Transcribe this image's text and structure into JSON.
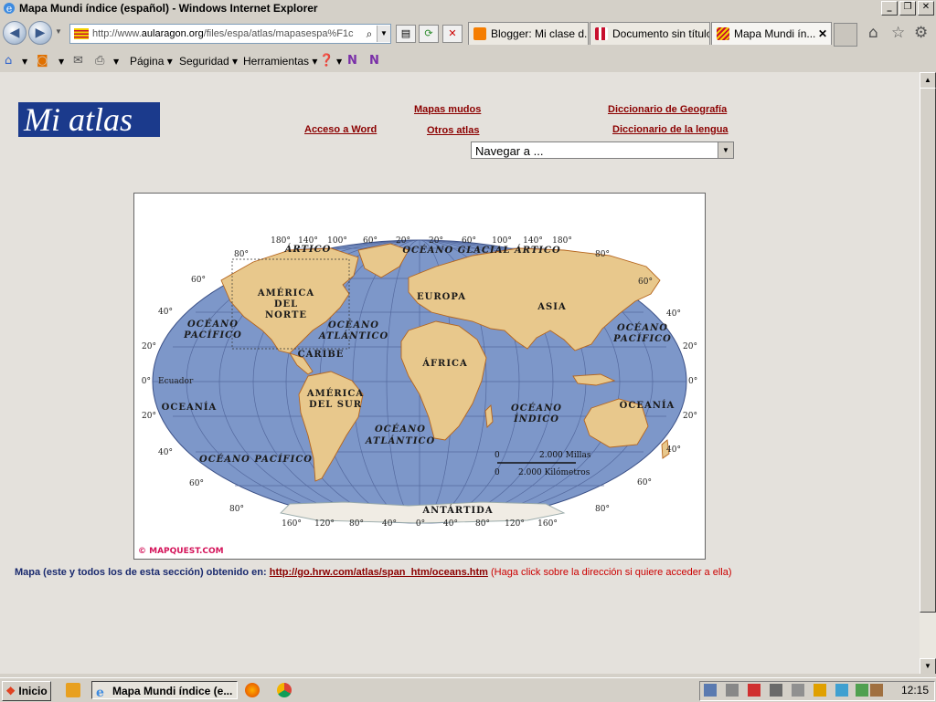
{
  "window": {
    "title": "Mapa Mundi índice (español) - Windows Internet Explorer"
  },
  "nav": {
    "url_prefix": "http://www.",
    "url_domain": "aularagon.org",
    "url_path": "/files/espa/atlas/mapasespa%F1c"
  },
  "tabs": [
    {
      "label": "Blogger: Mi clase d...",
      "color": "#f57d00"
    },
    {
      "label": "Documento sin título",
      "color": "#c8102e"
    },
    {
      "label": "Mapa Mundi ín...",
      "color": "#f4d000"
    }
  ],
  "commandbar": {
    "page": "Página",
    "security": "Seguridad",
    "tools": "Herramientas"
  },
  "page": {
    "logo": "Mi atlas",
    "links": {
      "mapas_mudos": "Mapas mudos",
      "dic_geografia": "Diccionario de Geografía",
      "acceso_word": "Acceso a Word",
      "otros_atlas": "Otros atlas",
      "dic_lengua": "Diccionario de la lengua"
    },
    "navigate_select": "Navegar a ...",
    "footer": {
      "text": "Mapa (este y todos los de esta sección) obtenido en:",
      "link": "http://go.hrw.com/atlas/span_htm/oceans.htm",
      "hint": "(Haga click sobre la dirección si quiere acceder a ella)"
    }
  },
  "map": {
    "top_longitudes": [
      "180°",
      "140°",
      "100°",
      "60°",
      "20°",
      "20°",
      "60°",
      "100°",
      "140°",
      "180°"
    ],
    "bottom_longitudes": [
      "160°",
      "120°",
      "80°",
      "40°",
      "0°",
      "40°",
      "80°",
      "120°",
      "160°"
    ],
    "left_latitudes": [
      "80°",
      "60°",
      "40°",
      "20°",
      "0°",
      "20°",
      "40°",
      "60°",
      "80°"
    ],
    "right_latitudes": [
      "80°",
      "60°",
      "40°",
      "20°",
      "0°",
      "20°",
      "40°",
      "60°",
      "80°"
    ],
    "equator": "Ecuador",
    "labels": {
      "artico": "ÁRTICO",
      "glacial": "OCÉANO GLACIAL ÁRTICO",
      "america_norte_1": "AMÉRICA",
      "america_norte_2": "DEL",
      "america_norte_3": "NORTE",
      "europa": "EUROPA",
      "asia": "ASIA",
      "pacifico_w1": "OCÉANO",
      "pacifico_w2": "PACÍFICO",
      "atlantico_n1": "OCÉANO",
      "atlantico_n2": "ATLÁNTICO",
      "pacifico_e1": "OCÉANO",
      "pacifico_e2": "PACÍFICO",
      "caribe": "CARIBE",
      "africa": "ÁFRICA",
      "oceania_w": "OCEANÍA",
      "america_sur_1": "AMÉRICA",
      "america_sur_2": "DEL SUR",
      "indico_1": "OCÉANO",
      "indico_2": "ÍNDICO",
      "oceania_e": "OCEANÍA",
      "atlantico_s1": "OCÉANO",
      "atlantico_s2": "ATLÁNTICO",
      "pacifico_s": "OCÉANO PACÍFICO",
      "antartida": "ANTÁRTIDA",
      "scale_miles": "2.000 Millas",
      "scale_km": "2.000 Kilómetros",
      "scale_zero": "0",
      "copyright": "© MAPQUEST.COM"
    }
  },
  "taskbar": {
    "start": "Inicio",
    "active_window": "Mapa Mundi índice (e...",
    "time": "12:15"
  }
}
